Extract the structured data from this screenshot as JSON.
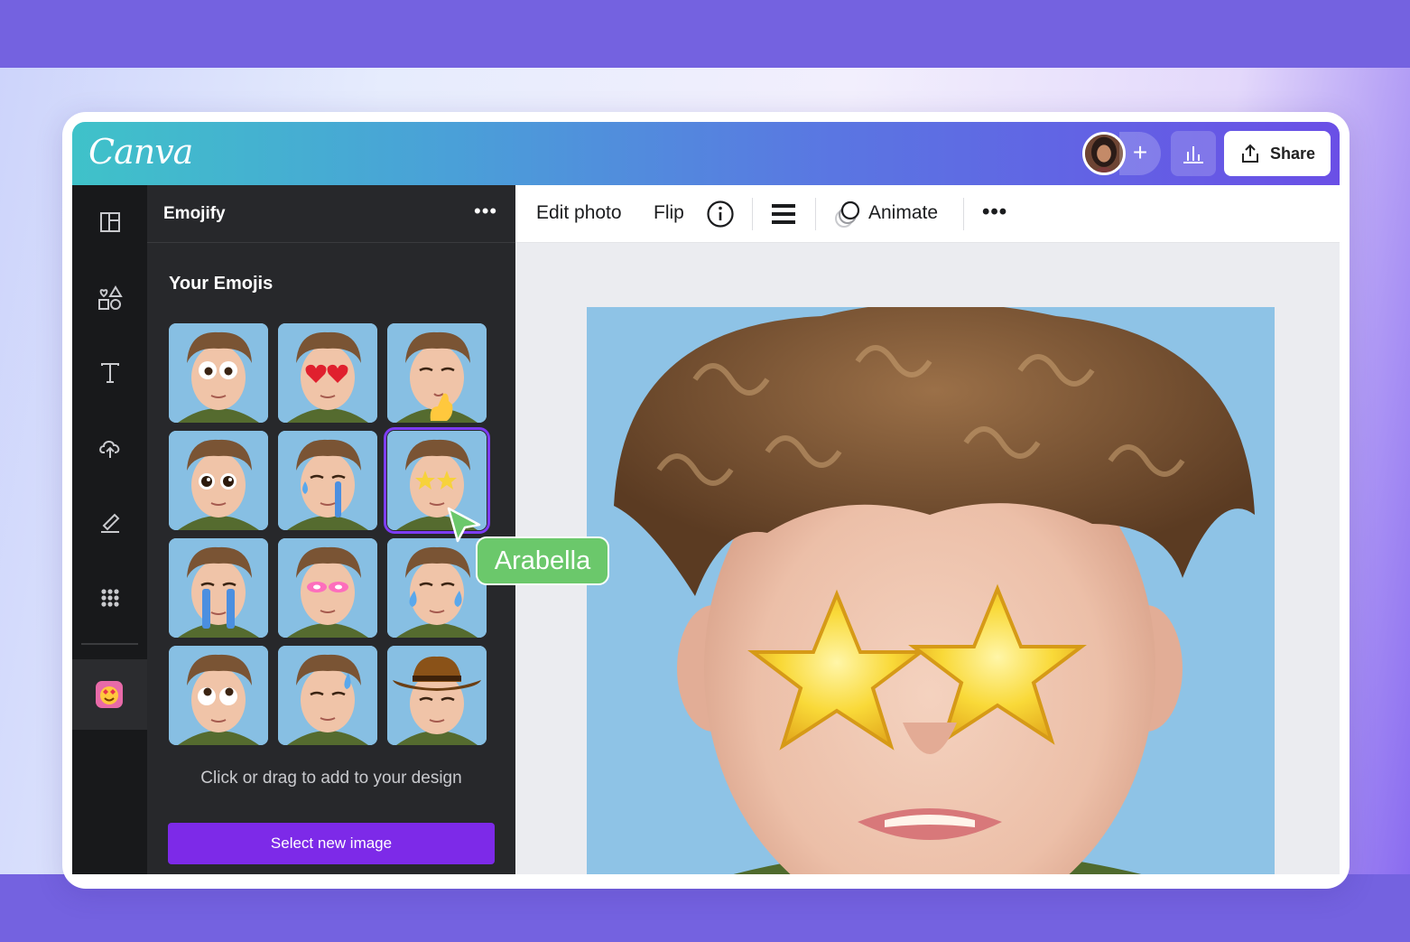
{
  "app": {
    "logo": "Canva"
  },
  "header": {
    "share_label": "Share",
    "add_label": "+"
  },
  "sidebar": {
    "items": [
      {
        "name": "design",
        "icon": "layout-icon"
      },
      {
        "name": "elements",
        "icon": "shapes-icon"
      },
      {
        "name": "text",
        "icon": "text-icon"
      },
      {
        "name": "uploads",
        "icon": "cloud-upload-icon"
      },
      {
        "name": "draw",
        "icon": "draw-icon"
      },
      {
        "name": "apps",
        "icon": "apps-grid-icon"
      },
      {
        "name": "emojify",
        "icon": "emojify-app-icon"
      }
    ]
  },
  "panel": {
    "title": "Emojify",
    "more_label": "•••",
    "section_title": "Your Emojis",
    "emojis": [
      {
        "effect": "googly-eyes"
      },
      {
        "effect": "heart-eyes"
      },
      {
        "effect": "thumbs-up"
      },
      {
        "effect": "big-eyes"
      },
      {
        "effect": "tears"
      },
      {
        "effect": "star-eyes",
        "selected": true
      },
      {
        "effect": "crying-streams"
      },
      {
        "effect": "glowing-eyes"
      },
      {
        "effect": "sweat-drops"
      },
      {
        "effect": "rolling-eyes"
      },
      {
        "effect": "sweat-drop"
      },
      {
        "effect": "cowboy-hat"
      }
    ],
    "hint": "Click or drag to add to your design",
    "select_button": "Select new image"
  },
  "toolbar": {
    "edit_photo": "Edit photo",
    "flip": "Flip",
    "animate": "Animate",
    "more_label": "•••"
  },
  "cursor": {
    "collaborator": "Arabella",
    "color": "#6bc86b"
  },
  "colors": {
    "brand_purple": "#7d2ae8",
    "band": "#7462e0",
    "panel_bg": "#27282b",
    "rail_bg": "#18191b"
  }
}
